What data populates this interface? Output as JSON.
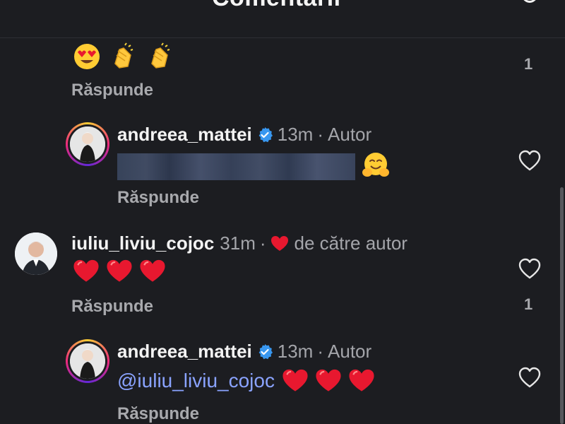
{
  "header": {
    "title": "Comentarii"
  },
  "comments": [
    {
      "reply_label": "Răspunde",
      "likes": "1",
      "emojis": [
        "heart-eyes",
        "clapping-hands",
        "clapping-hands"
      ]
    },
    {
      "username": "andreea_mattei",
      "verified": true,
      "time": "13m",
      "separator": "·",
      "tag": "Autor",
      "text_hidden": true,
      "emoji": "hugging-face",
      "reply_label": "Răspunde"
    },
    {
      "username": "iuliu_liviu_cojoc",
      "time": "31m",
      "separator": "·",
      "liked_by_author": "de către autor",
      "emojis": [
        "red-heart",
        "red-heart",
        "red-heart"
      ],
      "reply_label": "Răspunde",
      "likes": "1"
    },
    {
      "username": "andreea_mattei",
      "verified": true,
      "time": "13m",
      "separator": "·",
      "tag": "Autor",
      "mention": "@iuliu_liviu_cojoc",
      "emojis": [
        "red-heart",
        "red-heart",
        "red-heart"
      ],
      "reply_label": "Răspunde"
    }
  ],
  "colors": {
    "background": "#1c1d21",
    "muted_text": "#a4a5aa",
    "mention": "#8aa3ff",
    "verified_badge": "#3897f0",
    "heart": "#e8182f"
  }
}
